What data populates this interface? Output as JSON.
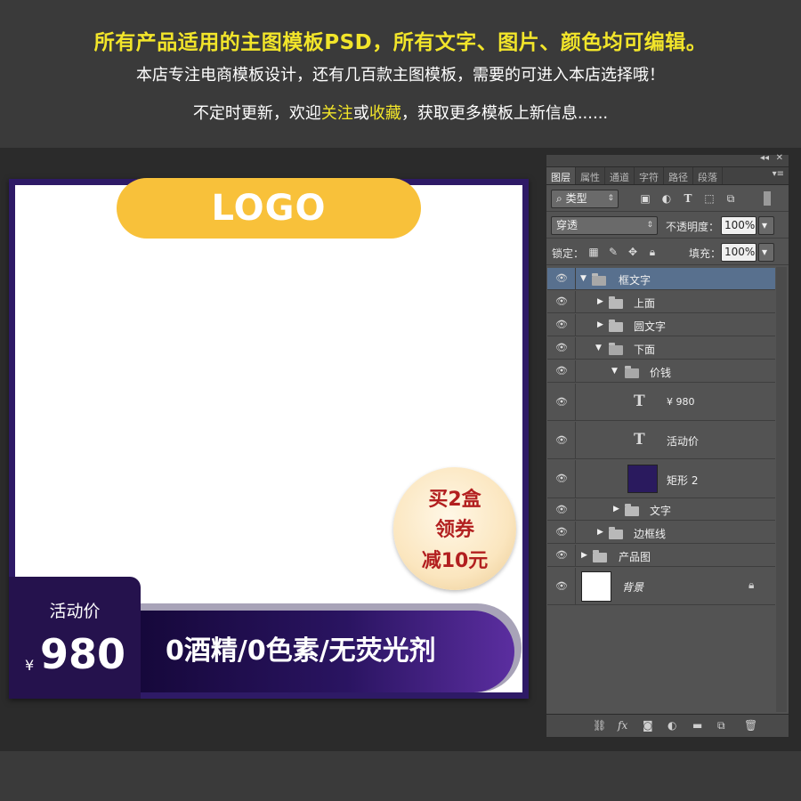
{
  "banner": {
    "line1": "所有产品适用的主图模板PSD，所有文字、图片、颜色均可编辑。",
    "line2": "本店专注电商模板设计，还有几百款主图模板，需要的可进入本店选择哦！",
    "line3_pre": "不定时更新，欢迎",
    "line3_follow": "关注",
    "line3_or": "或",
    "line3_fav": "收藏",
    "line3_post": "，获取更多模板上新信息......"
  },
  "template": {
    "logo": "LOGO",
    "coupon": [
      "买2盒",
      "领券",
      "减10元"
    ],
    "price_label": "活动价",
    "currency": "¥",
    "price": "980",
    "slogan": "0酒精/0色素/无荧光剂"
  },
  "colors": {
    "highlight": "#f2e52a",
    "canvas_border": "#2e1a66",
    "logo_bg": "#f8c13a",
    "coupon_text": "#b21f1f",
    "selected_layer": "#58708e"
  },
  "layers_panel": {
    "tabs": [
      "图层",
      "属性",
      "通道",
      "字符",
      "路径",
      "段落"
    ],
    "filter_label": "类型",
    "blend_mode": "穿透",
    "opacity_label": "不透明度：",
    "opacity_value": "100%",
    "lock_label": "锁定：",
    "fill_label": "填充：",
    "fill_value": "100%",
    "layers": [
      {
        "name": "框文字",
        "kind": "group",
        "expanded": true,
        "selected": true
      },
      {
        "name": "上面",
        "kind": "group",
        "expanded": false
      },
      {
        "name": "圆文字",
        "kind": "group",
        "expanded": false
      },
      {
        "name": "下面",
        "kind": "group",
        "expanded": true
      },
      {
        "name": "价钱",
        "kind": "group",
        "expanded": true
      },
      {
        "name": "¥ 980",
        "kind": "text"
      },
      {
        "name": "活动价",
        "kind": "text"
      },
      {
        "name": "矩形 2",
        "kind": "shape"
      },
      {
        "name": "文字",
        "kind": "group",
        "expanded": false
      },
      {
        "name": "边框线",
        "kind": "group",
        "expanded": false
      },
      {
        "name": "产品图",
        "kind": "group",
        "expanded": false
      },
      {
        "name": "背景",
        "kind": "background",
        "locked": true
      }
    ],
    "bottom_icons": [
      "link-icon",
      "fx-icon",
      "mask-icon",
      "adjustment-icon",
      "new-group-icon",
      "new-layer-icon",
      "trash-icon"
    ]
  }
}
